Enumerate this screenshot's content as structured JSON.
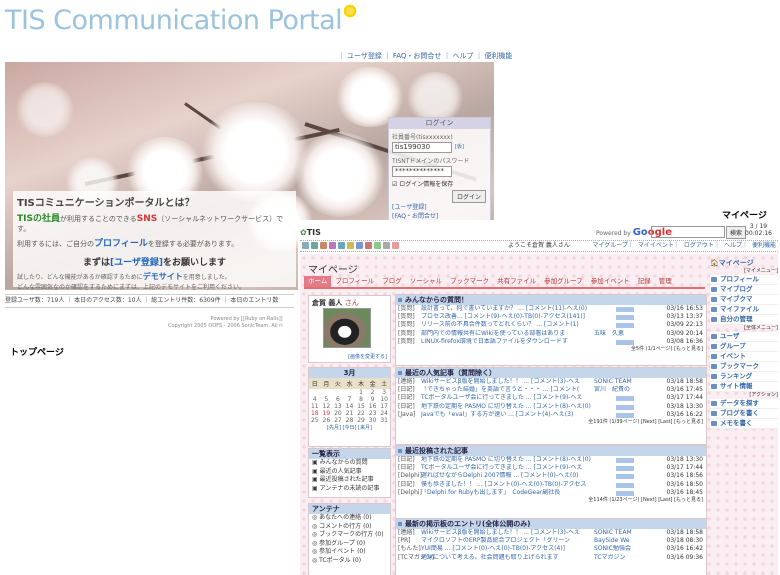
{
  "top": {
    "logo_text": "TIS Communication Portal",
    "links": [
      "ユーザ登録",
      "FAQ・お問合せ",
      "ヘルプ",
      "便利機能"
    ],
    "login": {
      "heading": "ログイン",
      "id_label": "社員番号(tisxxxxxxx)",
      "id_value": "tis199030",
      "id_link": "[仮]",
      "pw_label": "TISNTドメインのパスワード",
      "pw_value": "**************",
      "remember": "ログイン情報を保存",
      "button": "ログイン",
      "link1": "[ユーザ登録]",
      "link2": "[FAQ・お問合せ]"
    },
    "intro": {
      "title": "TISコミュニケーションポータルとは？",
      "line1_a": "TISの社員",
      "line1_b": "が利用することのできる",
      "line1_sns": "SNS",
      "line1_c": "（ソーシャルネットワークサービス）です。",
      "line2_a": "利用するには、ご自分の",
      "line2_b": "プロフィール",
      "line2_c": "を登録する必要があります。",
      "call_a": "まずは",
      "call_b": "[ユーザ登録]",
      "call_c": "をお願いします",
      "note1": "試したり、どんな機能があるか確認するために",
      "note_demo": "デモサイト",
      "note2": "を用意しました。",
      "note3": "どんな雰囲気なのか確認をするためにまずは、上記のデモサイトをご利用ください。"
    },
    "stats": "登録ユーザ数：719人 ｜ 本日のアクセス数：10人 ｜ 総エントリ件数：6309件 ｜ 本日のエントリ数",
    "copyright1": "Powered by [[Ruby on Rails]]",
    "copyright2": "Copyright 2005 OOFS - 2006 SonicTeam. All ri"
  },
  "labels": {
    "top_page": "トップページ",
    "my_page": "マイページ"
  },
  "mypage": {
    "logo": "TIS",
    "powered": "Powered by",
    "google_g": "Go",
    "google_o": "ogle",
    "search_btn": "検索",
    "date1": "3 / 19",
    "date2": "00:02:16",
    "welcome": "ようこそ倉賀 義人さん",
    "nav_links": [
      "マイグループ",
      "マイイベント",
      "ログアウト",
      "ヘルプ",
      "便利機能"
    ],
    "title": "マイページ",
    "tabs": [
      "ホーム",
      "プロフィール",
      "ブログ",
      "ソーシャル",
      "ブックマーク",
      "共有ファイル",
      "参加グループ",
      "参加イベント",
      "記録",
      "管理"
    ],
    "profile": {
      "name": "倉賀 義人",
      "suffix": "さん",
      "change": "[画像を変更する]"
    },
    "calendar": {
      "month": "3月",
      "days": [
        "日",
        "月",
        "火",
        "水",
        "木",
        "金",
        "土"
      ],
      "weeks": [
        [
          "",
          "",
          "",
          "",
          "1",
          "2",
          "3"
        ],
        [
          "4",
          "5",
          "6",
          "7",
          "8",
          "9",
          "10"
        ],
        [
          "11",
          "12",
          "13",
          "14",
          "15",
          "16",
          "17"
        ],
        [
          "18",
          "19",
          "20",
          "21",
          "22",
          "23",
          "24"
        ],
        [
          "25",
          "26",
          "27",
          "28",
          "29",
          "30",
          "31"
        ]
      ],
      "nav": "[先月] [今日] [来月]"
    },
    "lists": {
      "heading": "一覧表示",
      "items": [
        "みんなからの質問",
        "最近の人気記事",
        "最近投稿された記事",
        "アンテナの未読の記事"
      ]
    },
    "antenna": {
      "heading": "アンテナ",
      "items": [
        "あなたへの連絡 (0)",
        "コメントの行方 (0)",
        "ブックマークの行方 (0)",
        "参加グループ (0)",
        "参加イベント (0)",
        "TCポータル (0)"
      ]
    },
    "questions": {
      "heading": "みんなからの質問！",
      "rows": [
        {
          "tag": "[質問]",
          "title": "設計書って、何で書いていますか？ ... [コメント(11)-ヘえ(0)",
          "user": "",
          "date": "03/16 16:53"
        },
        {
          "tag": "[質問]",
          "title": "プロセス改善... [コメント(9)-ヘえ(0)-TB(0)-アクセス(141)]",
          "user": "",
          "date": "03/13 13:37"
        },
        {
          "tag": "[質問]",
          "title": "リリース前の不具合件数ってどれくらい？ ... [コメント(1)",
          "user": "",
          "date": "03/09 22:13"
        },
        {
          "tag": "[質問]",
          "title": "部門内での情報共有にWikiを使っている部署はありま",
          "user": "五味　久恵",
          "date": "03/09 20:14"
        },
        {
          "tag": "[質問]",
          "title": "LINUX-firefox環境で日本語ファイルをダウンロードす",
          "user": "",
          "date": "03/08 16:36"
        }
      ],
      "footer": "全5件 (1/1ページ) [もっと見る]"
    },
    "popular": {
      "heading": "最近の人気記事（質問除く）",
      "rows": [
        {
          "tag": "[連絡]",
          "title": "Wikiサービスβ版を開始しました！！ ... [コメント(3)-ヘえ",
          "user": "SONIC TEAM",
          "date": "03/18 18:58"
        },
        {
          "tag": "[日記]",
          "title": "「できちゃった結婚」を英語で言うと・・・ ... [コメント(",
          "user": "宮川　紀貴の",
          "date": "03/16 17:45"
        },
        {
          "tag": "[日記]",
          "title": "TCポータルユーザ会に行ってきました ... [コメント(9)-ヘえ",
          "user": "",
          "date": "03/17 17:44"
        },
        {
          "tag": "[日記]",
          "title": "地下鉄の定期を PASMO に切り替えた ... [コメント(8)-ヘえ(0)",
          "user": "",
          "date": "03/18 13:30"
        },
        {
          "tag": "[Java]",
          "title": "Javaでも「eval」する方が速い ... [コメント(4)-ヘえ(3)",
          "user": "",
          "date": "03/16 16:22"
        }
      ],
      "footer": "全191件 (1/39ページ) [Next] [Last] [もっと見る]"
    },
    "recent": {
      "heading": "最近投稿された記事",
      "rows": [
        {
          "tag": "[日記]",
          "title": "地下鉄の定期を PASMO に切り替えた ... [コメント(8)-ヘえ(0)",
          "user": "",
          "date": "03/18 13:30"
        },
        {
          "tag": "[日記]",
          "title": "TCポータルユーザ会に行ってきました ... [コメント(9)-ヘえ",
          "user": "",
          "date": "03/17 17:44"
        },
        {
          "tag": "[Delphi]",
          "title": "遅ればせながらDelphi 2007情報 ... [コメント(0)-ヘえ(0)",
          "user": "",
          "date": "03/16 18:56"
        },
        {
          "tag": "[日記]",
          "title": "僕も歩きました！！ ... [コメント(0)-ヘえ(0)-TB(0)-アクセス",
          "user": "",
          "date": "03/16 18:50"
        },
        {
          "tag": "[Delphi]",
          "title": "「Delphi for Rubyも出します」　CodeGear副社長",
          "user": "",
          "date": "03/16 18:45"
        }
      ],
      "footer": "全114件 (1/23ページ) [Next] [Last] [もっと見る]"
    },
    "antenna_new": {
      "heading": "最新の掲示板のエントリ(全体公開のみ)",
      "rows": [
        {
          "tag": "[連絡]",
          "title": "Wikiサービスβ版を開始しました！！ ... [コメント(3)-ヘえ",
          "user": "SONIC TEAM",
          "date": "03/18 18:58"
        },
        {
          "tag": "[PR]",
          "title": "マイクロソフトのERP製品統合プロジェクト「グリーン",
          "user": "BaySide We",
          "date": "03/18 08:30"
        },
        {
          "tag": "[もんた]",
          "title": "YUI簡易 ... [コメント(0)-ヘえ(0)-TB(0)-アクセス(4)]",
          "user": "SONIC勉強会",
          "date": "03/16 16:42"
        },
        {
          "tag": "[TCマガジン]",
          "title": "地球について考える。社会問題も取り上げられます",
          "user": "TCマガジン",
          "date": "03/16 09:36"
        }
      ]
    },
    "sidebar": {
      "mypage": "マイページ",
      "sec_menu": "[マイメニュー]",
      "menu": [
        "プロフィール",
        "マイブログ",
        "マイブクマ",
        "マイファイル",
        "自分の管理"
      ],
      "sec_all": "[全体メニュー]",
      "all": [
        "ユーザ",
        "グループ",
        "イベント",
        "ブックマーク",
        "ランキング",
        "サイト情報"
      ],
      "sec_action": "[アクション]",
      "action": [
        "データを探す",
        "ブログを書く",
        "メモを書く"
      ]
    }
  }
}
